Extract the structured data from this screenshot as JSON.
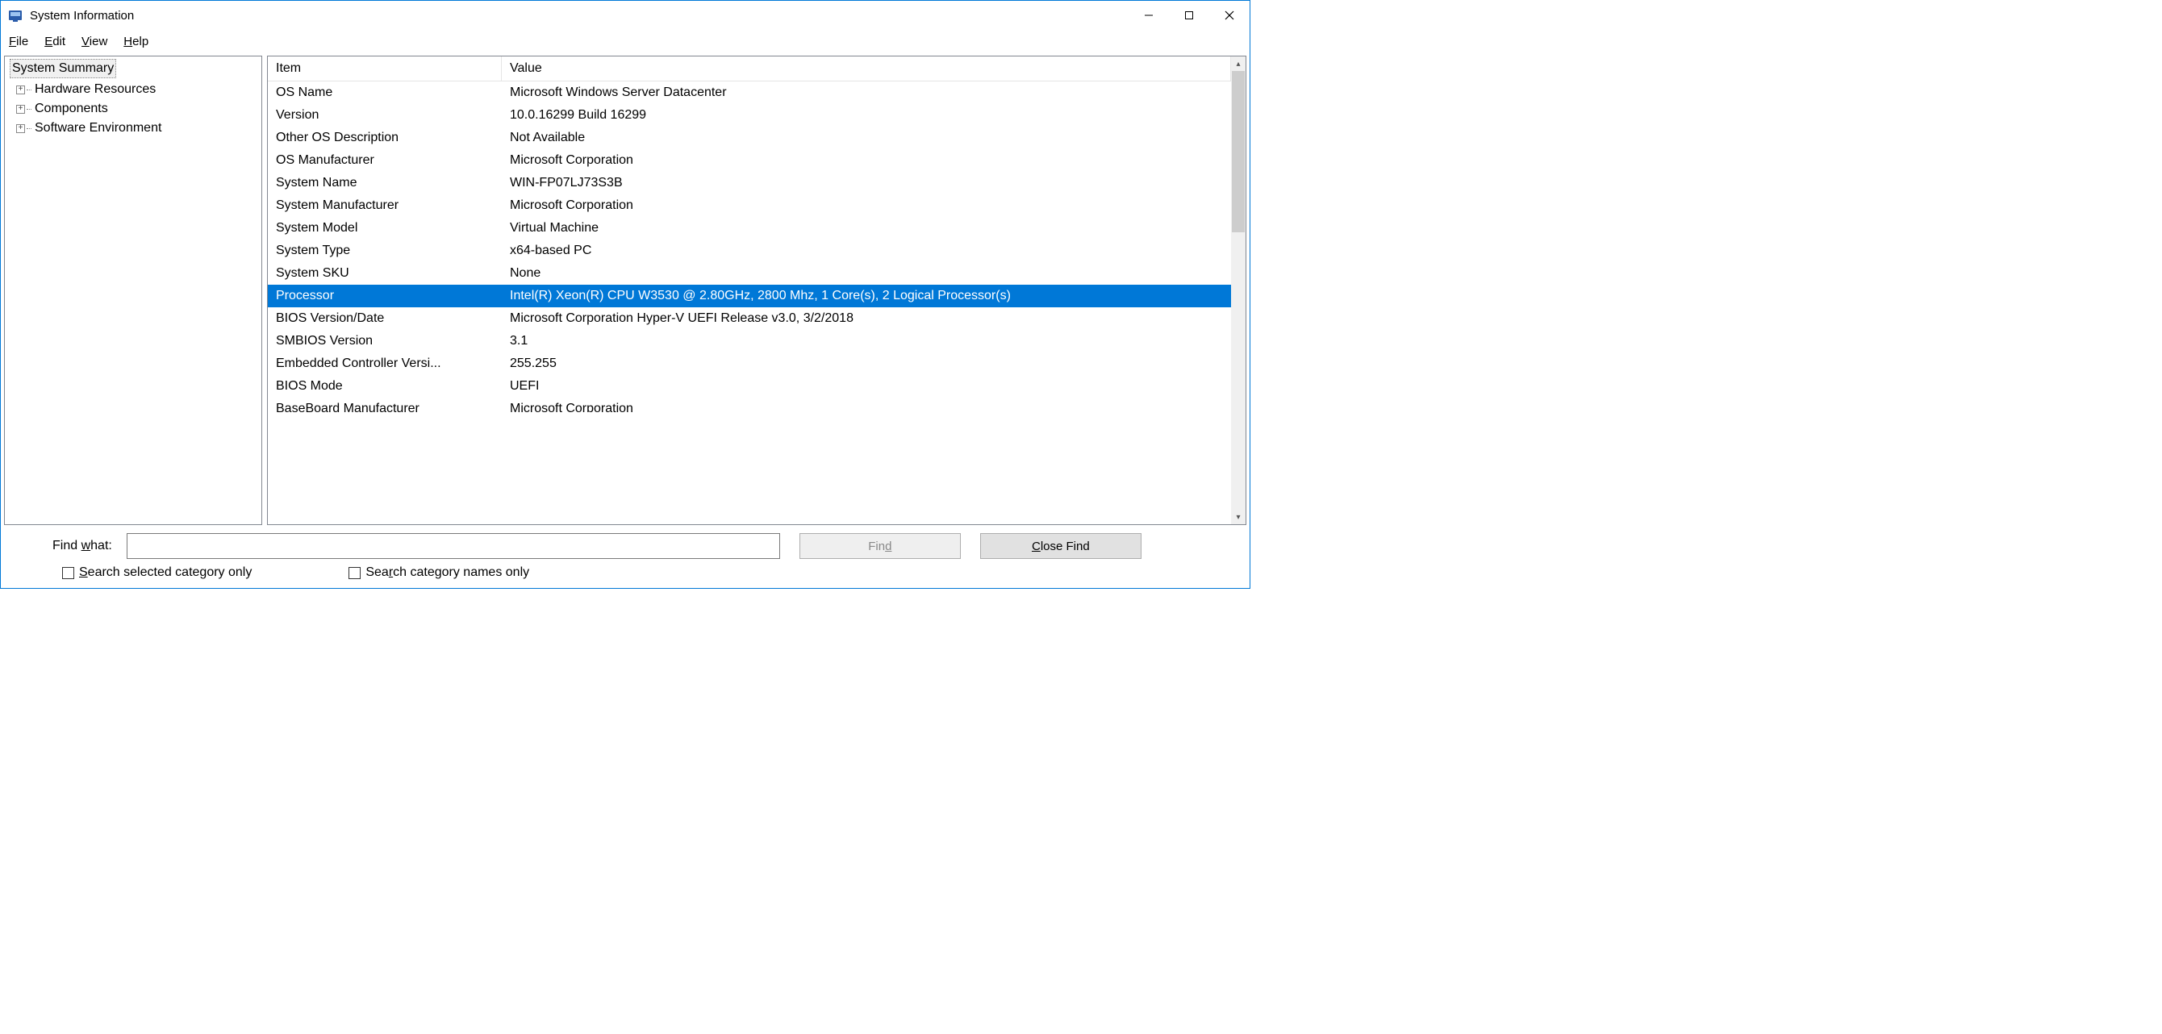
{
  "window": {
    "title": "System Information"
  },
  "menu": {
    "file": "File",
    "edit": "Edit",
    "view": "View",
    "help": "Help"
  },
  "tree": {
    "root": "System Summary",
    "items": [
      "Hardware Resources",
      "Components",
      "Software Environment"
    ]
  },
  "list": {
    "headers": {
      "item": "Item",
      "value": "Value"
    },
    "rows": [
      {
        "item": "OS Name",
        "value": "Microsoft Windows Server Datacenter"
      },
      {
        "item": "Version",
        "value": "10.0.16299 Build 16299"
      },
      {
        "item": "Other OS Description",
        "value": "Not Available"
      },
      {
        "item": "OS Manufacturer",
        "value": "Microsoft Corporation"
      },
      {
        "item": "System Name",
        "value": "WIN-FP07LJ73S3B"
      },
      {
        "item": "System Manufacturer",
        "value": "Microsoft Corporation"
      },
      {
        "item": "System Model",
        "value": "Virtual Machine"
      },
      {
        "item": "System Type",
        "value": "x64-based PC"
      },
      {
        "item": "System SKU",
        "value": "None"
      },
      {
        "item": "Processor",
        "value": "Intel(R) Xeon(R) CPU           W3530  @ 2.80GHz, 2800 Mhz, 1 Core(s), 2 Logical Processor(s)",
        "selected": true
      },
      {
        "item": "BIOS Version/Date",
        "value": "Microsoft Corporation Hyper-V UEFI Release v3.0, 3/2/2018"
      },
      {
        "item": "SMBIOS Version",
        "value": "3.1"
      },
      {
        "item": "Embedded Controller Versi...",
        "value": "255.255"
      },
      {
        "item": "BIOS Mode",
        "value": "UEFI"
      }
    ],
    "partial": {
      "item": "BaseBoard Manufacturer",
      "value": "Microsoft Corporation"
    }
  },
  "find": {
    "label": "Find what:",
    "value": "",
    "find_btn": "Find",
    "close_btn": "Close Find",
    "chk_selected": "Search selected category only",
    "chk_names": "Search category names only"
  }
}
